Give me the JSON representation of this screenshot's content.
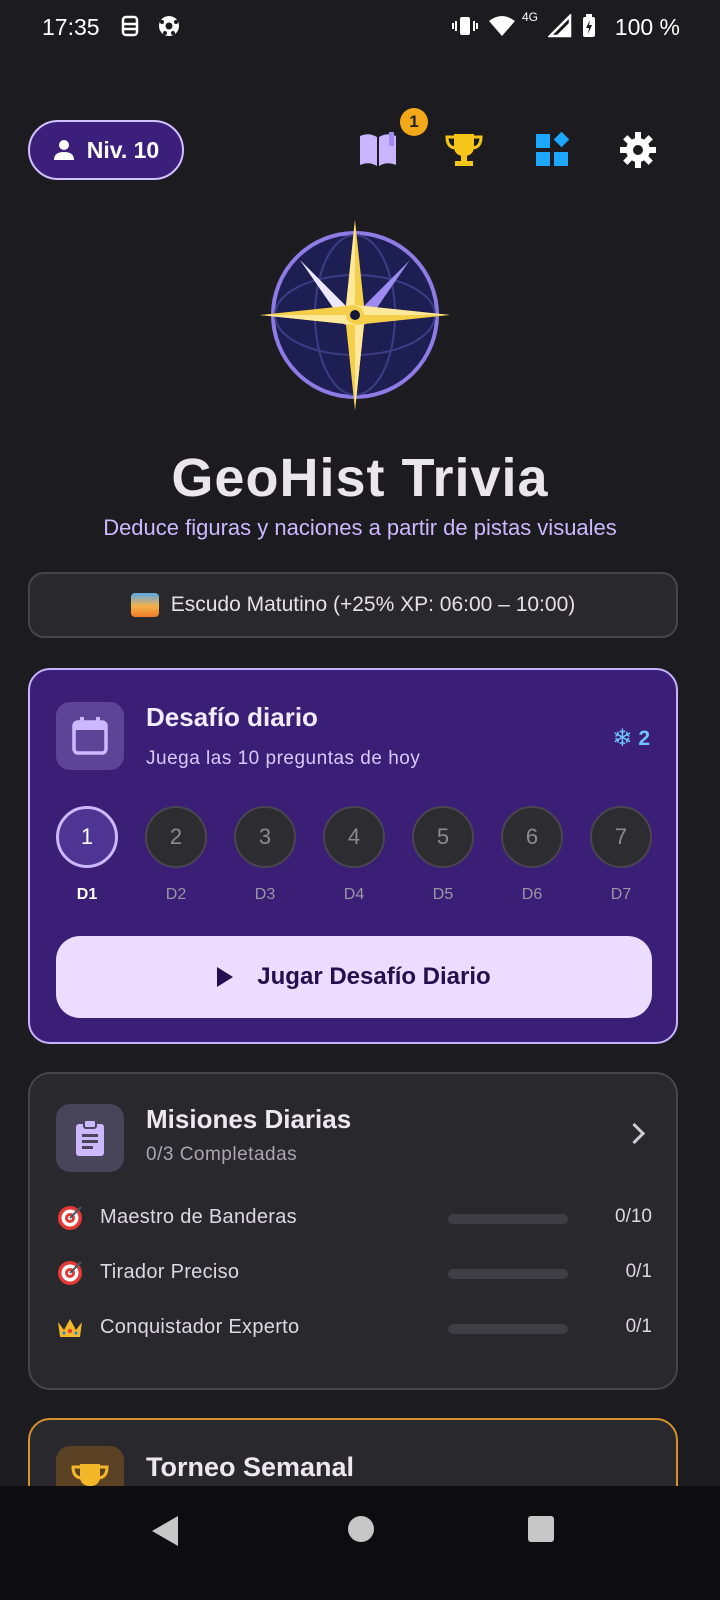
{
  "status_bar": {
    "time": "17:35",
    "battery": "100 %",
    "network": "4G",
    "icons": [
      "vpn-key-icon",
      "soccer-ball-icon",
      "vibrate-icon",
      "wifi-icon",
      "signal-icon",
      "battery-charging-icon"
    ]
  },
  "top_bar": {
    "level_label": "Niv. 10",
    "notification_count": "1",
    "icons": [
      "book-icon",
      "trophy-icon",
      "widgets-icon",
      "gear-icon"
    ]
  },
  "hero": {
    "title": "GeoHist Trivia",
    "subtitle": "Deduce figuras y naciones a partir de pistas visuales"
  },
  "bonus_banner": {
    "text": "Escudo Matutino (+25% XP: 06:00 – 10:00)"
  },
  "daily_challenge": {
    "title": "Desafío diario",
    "subtitle": "Juega las 10 preguntas de hoy",
    "freeze_count": "2",
    "days": [
      {
        "number": "1",
        "label": "D1",
        "active": true
      },
      {
        "number": "2",
        "label": "D2",
        "active": false
      },
      {
        "number": "3",
        "label": "D3",
        "active": false
      },
      {
        "number": "4",
        "label": "D4",
        "active": false
      },
      {
        "number": "5",
        "label": "D5",
        "active": false
      },
      {
        "number": "6",
        "label": "D6",
        "active": false
      },
      {
        "number": "7",
        "label": "D7",
        "active": false
      }
    ],
    "play_label": "Jugar Desafío Diario"
  },
  "missions": {
    "title": "Misiones Diarias",
    "subtitle": "0/3 Completadas",
    "items": [
      {
        "name": "Maestro de Banderas",
        "count": "0/10",
        "progress": 0,
        "icon": "target-icon"
      },
      {
        "name": "Tirador Preciso",
        "count": "0/1",
        "progress": 0,
        "icon": "target-icon"
      },
      {
        "name": "Conquistador Experto",
        "count": "0/1",
        "progress": 0,
        "icon": "crown-icon"
      }
    ]
  },
  "tournament": {
    "title": "Torneo Semanal"
  },
  "colors": {
    "background": "#1c1b1f",
    "accent_purple": "#3b1f76",
    "accent_gold": "#f2c744",
    "freeze_blue": "#6fc3ff"
  }
}
